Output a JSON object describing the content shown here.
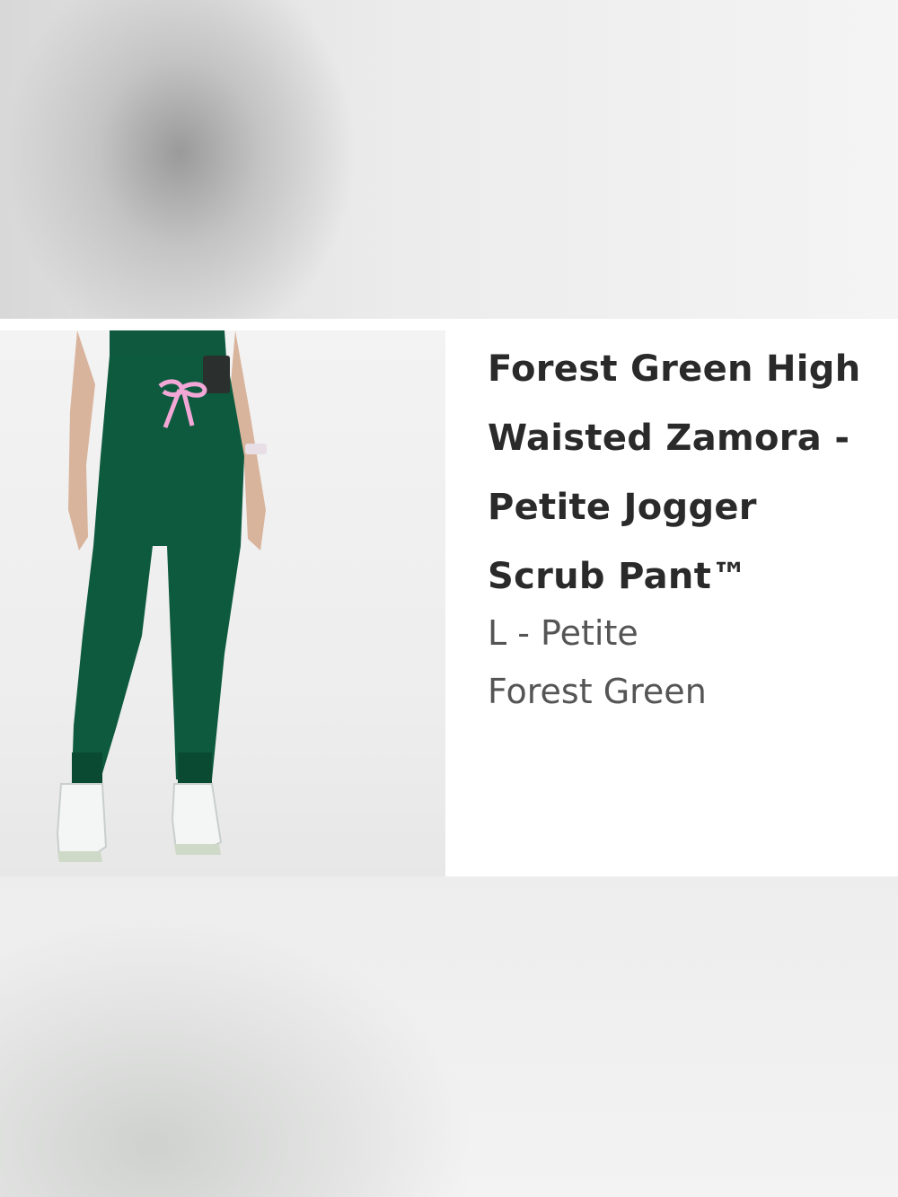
{
  "product": {
    "title": "Forest Green High Waisted Zamora - Petite Jogger Scrub Pant™",
    "size": "L - Petite",
    "color_name": "Forest Green"
  },
  "colors": {
    "pant": "#0d5a3e",
    "drawstring": "#f2a7d6",
    "sneaker": "#f4f5f5"
  }
}
